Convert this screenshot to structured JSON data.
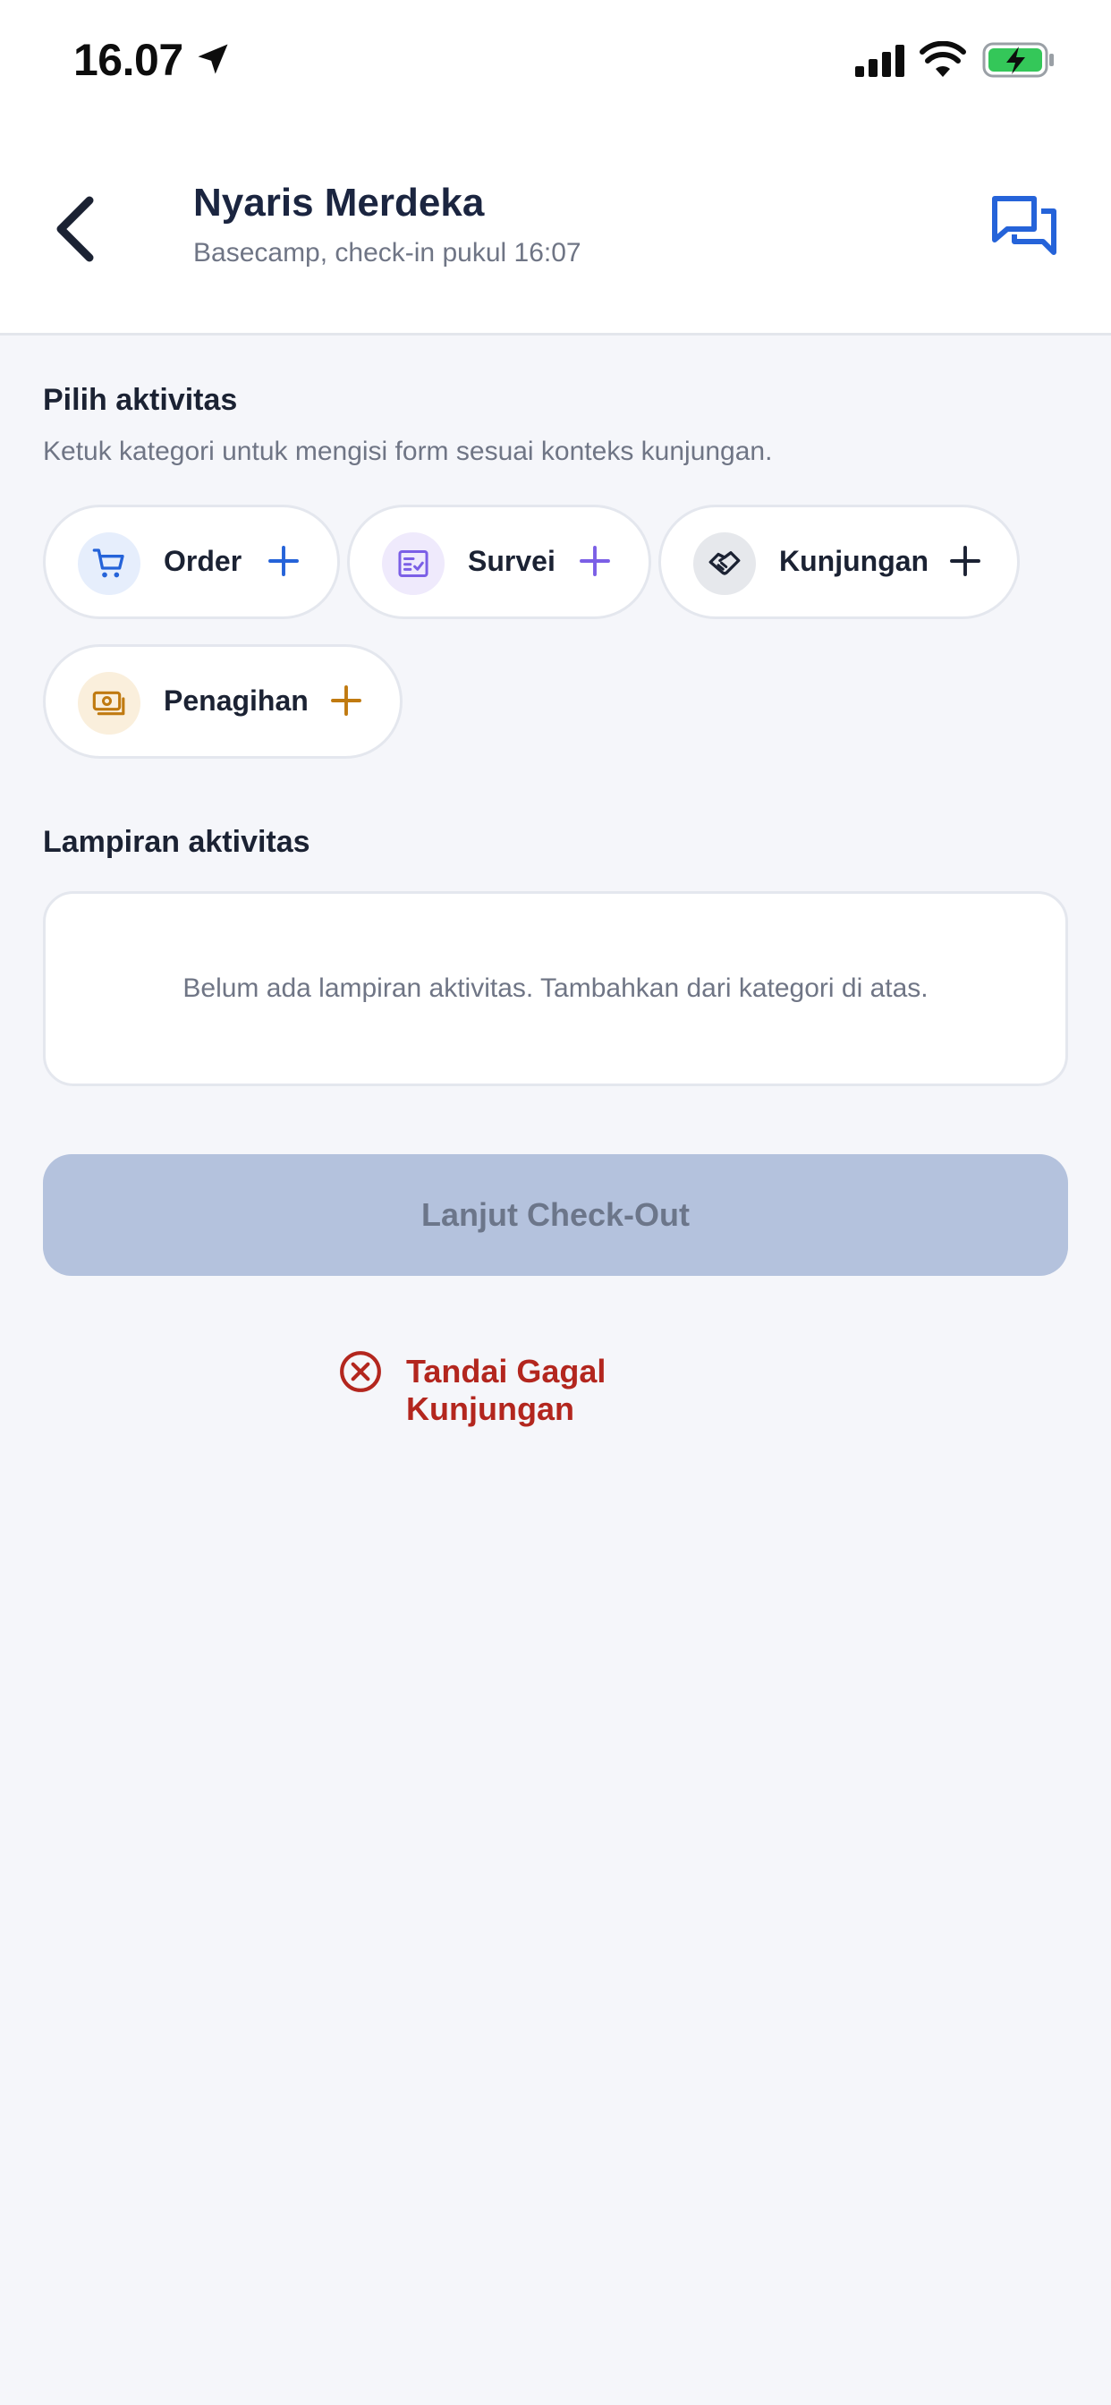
{
  "status_bar": {
    "time": "16.07",
    "icons": [
      "location-arrow-icon",
      "cellular-signal-icon",
      "wifi-icon",
      "battery-charging-icon"
    ]
  },
  "header": {
    "title": "Nyaris Merdeka",
    "subtitle": "Basecamp, check-in pukul 16:07",
    "back_icon": "chevron-left-icon",
    "chat_icon": "chat-bubbles-icon"
  },
  "activities": {
    "title": "Pilih aktivitas",
    "hint": "Ketuk kategori untuk mengisi form sesuai konteks kunjungan.",
    "chips": [
      {
        "label": "Order",
        "icon": "cart-icon",
        "color": "#2563d9",
        "icon_bg": "#e6eefc"
      },
      {
        "label": "Survei",
        "icon": "survey-form-icon",
        "color": "#7b5fe6",
        "icon_bg": "#efeafc"
      },
      {
        "label": "Kunjungan",
        "icon": "handshake-icon",
        "color": "#1b2233",
        "icon_bg": "#e6e8ec"
      },
      {
        "label": "Penagihan",
        "icon": "money-icon",
        "color": "#c07a10",
        "icon_bg": "#faefdc"
      }
    ]
  },
  "attachments": {
    "title": "Lampiran aktivitas",
    "empty_text": "Belum ada lampiran aktivitas. Tambahkan dari kategori di atas."
  },
  "actions": {
    "checkout_label": "Lanjut Check-Out",
    "fail_label": "Tandai Gagal Kunjungan",
    "fail_color": "#b3261e"
  }
}
